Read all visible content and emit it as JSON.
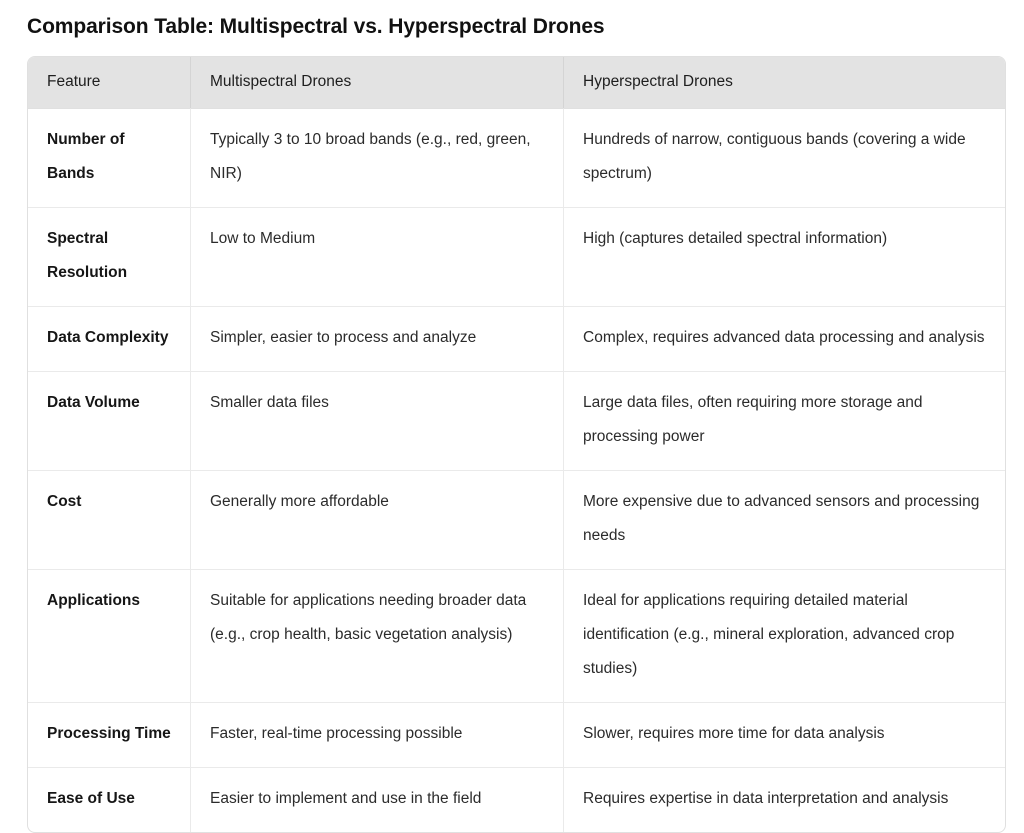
{
  "page": {
    "title": "Comparison Table: Multispectral vs. Hyperspectral Drones",
    "background_color": "#ffffff",
    "header_background_color": "#e3e3e3",
    "border_color": "#e0e0e0"
  },
  "table": {
    "columns": [
      "Feature",
      "Multispectral Drones",
      "Hyperspectral Drones"
    ],
    "rows": [
      {
        "feature": "Number of Bands",
        "multispectral": "Typically 3 to 10 broad bands (e.g., red, green, NIR)",
        "hyperspectral": "Hundreds of narrow, contiguous bands (covering a wide spectrum)"
      },
      {
        "feature": "Spectral Resolution",
        "multispectral": "Low to Medium",
        "hyperspectral": "High (captures detailed spectral information)"
      },
      {
        "feature": "Data Complexity",
        "multispectral": "Simpler, easier to process and analyze",
        "hyperspectral": "Complex, requires advanced data processing and analysis"
      },
      {
        "feature": "Data Volume",
        "multispectral": "Smaller data files",
        "hyperspectral": "Large data files, often requiring more storage and processing power"
      },
      {
        "feature": "Cost",
        "multispectral": "Generally more affordable",
        "hyperspectral": "More expensive due to advanced sensors and processing needs"
      },
      {
        "feature": "Applications",
        "multispectral": "Suitable for applications needing broader data (e.g., crop health, basic vegetation analysis)",
        "hyperspectral": "Ideal for applications requiring detailed material identification (e.g., mineral exploration, advanced crop studies)"
      },
      {
        "feature": "Processing Time",
        "multispectral": "Faster, real-time processing possible",
        "hyperspectral": "Slower, requires more time for data analysis"
      },
      {
        "feature": "Ease of Use",
        "multispectral": "Easier to implement and use in the field",
        "hyperspectral": "Requires expertise in data interpretation and analysis"
      }
    ]
  }
}
